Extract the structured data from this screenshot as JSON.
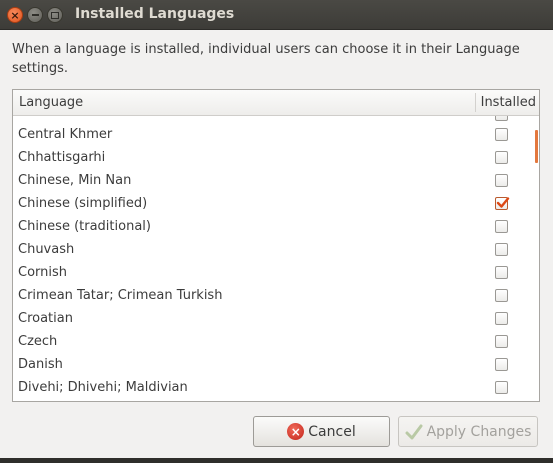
{
  "window": {
    "title": "Installed Languages",
    "close_glyph": "×",
    "min_glyph": "",
    "max_glyph": ""
  },
  "description": "When a language is installed, individual users can choose it in their Language settings.",
  "table": {
    "columns": {
      "language": "Language",
      "installed": "Installed"
    },
    "rows": [
      {
        "name": "Central Khmer",
        "installed": false
      },
      {
        "name": "Chhattisgarhi",
        "installed": false
      },
      {
        "name": "Chinese, Min Nan",
        "installed": false
      },
      {
        "name": "Chinese (simplified)",
        "installed": true
      },
      {
        "name": "Chinese (traditional)",
        "installed": false
      },
      {
        "name": "Chuvash",
        "installed": false
      },
      {
        "name": "Cornish",
        "installed": false
      },
      {
        "name": "Crimean Tatar; Crimean Turkish",
        "installed": false
      },
      {
        "name": "Croatian",
        "installed": false
      },
      {
        "name": "Czech",
        "installed": false
      },
      {
        "name": "Danish",
        "installed": false
      },
      {
        "name": "Divehi; Dhivehi; Maldivian",
        "installed": false
      }
    ]
  },
  "buttons": {
    "cancel": {
      "label": "Cancel",
      "icon": "cancel-icon"
    },
    "apply": {
      "label": "Apply Changes",
      "icon": "check-icon",
      "enabled": false
    }
  },
  "colors": {
    "accent": "#e3783e",
    "titlebar": "#3d3c38",
    "checkbox_checked": "#dd4814"
  }
}
